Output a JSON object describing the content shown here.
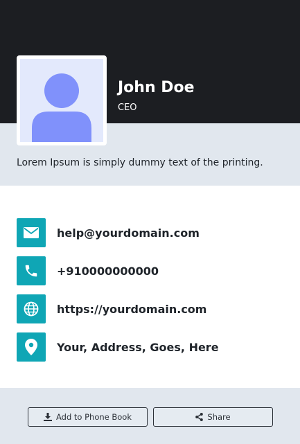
{
  "profile": {
    "name": "John Doe",
    "title": "CEO",
    "bio": "Lorem Ipsum is simply dummy text of the printing."
  },
  "contacts": [
    {
      "icon": "envelope-icon",
      "value": "help@yourdomain.com"
    },
    {
      "icon": "phone-icon",
      "value": "+910000000000"
    },
    {
      "icon": "globe-icon",
      "value": "https://yourdomain.com"
    },
    {
      "icon": "map-pin-icon",
      "value": "Your, Address, Goes, Here"
    }
  ],
  "actions": {
    "add_to_phone_book": "Add to Phone Book",
    "share": "Share"
  },
  "colors": {
    "header_bg": "#1c1e22",
    "band_bg": "#e1e7ee",
    "accent": "#0fa6b5",
    "avatar_fill": "#8091fb",
    "avatar_bg": "#e3e9fc"
  }
}
